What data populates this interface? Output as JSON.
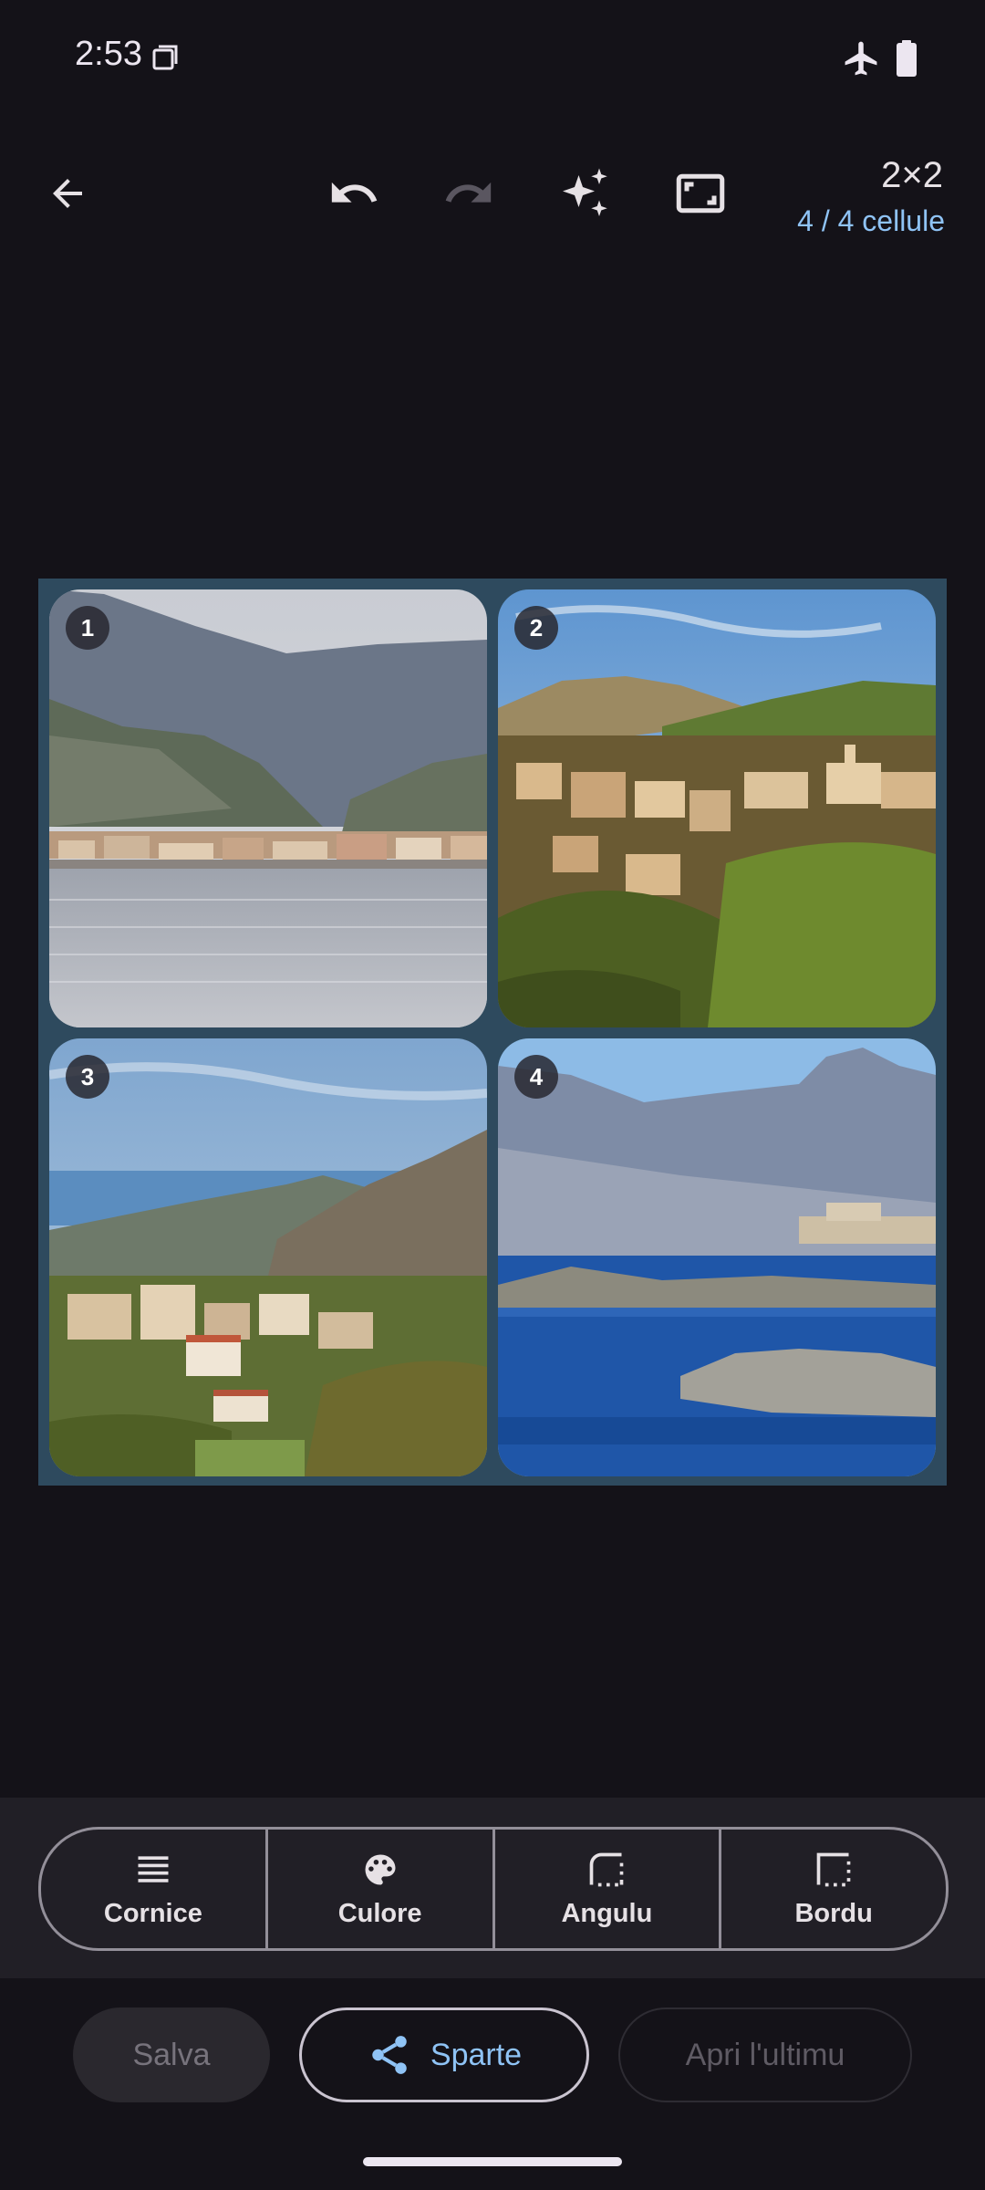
{
  "status_bar": {
    "time": "2:53",
    "icons": [
      "sim-card-icon",
      "airplane-mode-icon",
      "battery-icon"
    ]
  },
  "toolbar": {
    "icons": [
      "back-arrow-icon",
      "undo-icon",
      "redo-icon",
      "sparkle-icon",
      "aspect-ratio-icon"
    ],
    "grid_size": "2×2",
    "cell_count": "4 / 4 cellule"
  },
  "collage": {
    "border_color": "#2E4A5E",
    "cells": [
      {
        "number": "1",
        "subject": "coastal town on a bay below mountains"
      },
      {
        "number": "2",
        "subject": "hillside village with church at sunset"
      },
      {
        "number": "3",
        "subject": "village on green slopes above the sea"
      },
      {
        "number": "4",
        "subject": "blue bay with citadel and mountains"
      }
    ]
  },
  "tools": [
    {
      "label": "Cornice",
      "icon": "frame-lines-icon"
    },
    {
      "label": "Culore",
      "icon": "palette-icon"
    },
    {
      "label": "Angulu",
      "icon": "corner-radius-icon"
    },
    {
      "label": "Bordu",
      "icon": "border-style-icon"
    }
  ],
  "actions": {
    "save": "Salva",
    "share": "Sparte",
    "open_last": "Apri l'ultimu"
  },
  "colors": {
    "background": "#141218",
    "accent": "#8FC3F5",
    "panel": "#211F26"
  }
}
